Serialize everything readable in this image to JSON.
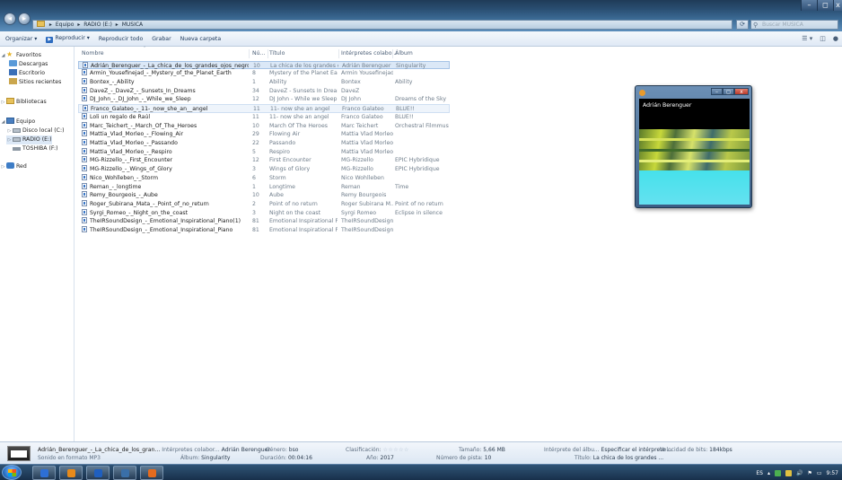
{
  "window": {
    "breadcrumb": [
      "Equipo",
      "RADIO (E:)",
      "MUSICA"
    ],
    "search_placeholder": "Buscar MUSICA",
    "controls": {
      "minimize": "–",
      "maximize": "◻",
      "close": "x"
    }
  },
  "toolbar": {
    "organize": "Organizar ▾",
    "play": "Reproducir ▾",
    "play_all": "Reproducir todo",
    "burn": "Grabar",
    "new_folder": "Nueva carpeta"
  },
  "nav": {
    "favorites": "Favoritos",
    "downloads": "Descargas",
    "desktop": "Escritorio",
    "recent": "Sitios recientes",
    "libraries": "Bibliotecas",
    "computer": "Equipo",
    "local_disk": "Disco local (C:)",
    "radio": "RADIO (E:)",
    "toshiba": "TOSHIBA (F:)",
    "network": "Red"
  },
  "columns": {
    "name": "Nombre",
    "num": "Nú...",
    "title": "Título",
    "artists": "Intérpretes colabo...",
    "album": "Álbum"
  },
  "files": [
    {
      "name": "Adrián_Berenguer_-_La_chica_de_los_grandes_ojos_negros",
      "num": "10",
      "title": "La chica de los grandes oj...",
      "artist": "Adrián Berenguer",
      "album": "Singularity"
    },
    {
      "name": "Armin_Yousefinejad_-_Mystery_of_the_Planet_Earth",
      "num": "8",
      "title": "Mystery of the Planet Earth",
      "artist": "Armin Yousefinejad",
      "album": ""
    },
    {
      "name": "Bontex_-_Ability",
      "num": "1",
      "title": "Ability",
      "artist": "Bontex",
      "album": "Ability"
    },
    {
      "name": "DaveZ_-_DaveZ_-_Sunsets_In_Dreams",
      "num": "34",
      "title": "DaveZ - Sunsets In Dreams",
      "artist": "DaveZ",
      "album": ""
    },
    {
      "name": "DJ_John_-_DJ_John_-_While_we_Sleep",
      "num": "12",
      "title": "DJ John - While we Sleep",
      "artist": "DJ John",
      "album": "Dreams of the Sky"
    },
    {
      "name": "Franco_Galateo_-_11-_now_she_an__angel",
      "num": "11",
      "title": "11- now she an angel",
      "artist": "Franco Galateo",
      "album": "BLUE!!"
    },
    {
      "name": "Loli un regalo de Raúl",
      "num": "11",
      "title": "11- now she an angel",
      "artist": "Franco Galateo",
      "album": "BLUE!!"
    },
    {
      "name": "Marc_Teichert_-_March_Of_The_Heroes",
      "num": "10",
      "title": "March Of The Heroes",
      "artist": "Marc Teichert",
      "album": "Orchestral Filmmusic..."
    },
    {
      "name": "Mattia_Vlad_Morleo_-_Flowing_Air",
      "num": "29",
      "title": "Flowing Air",
      "artist": "Mattia Vlad Morleo",
      "album": ""
    },
    {
      "name": "Mattia_Vlad_Morleo_-_Passando",
      "num": "22",
      "title": "Passando",
      "artist": "Mattia Vlad Morleo",
      "album": ""
    },
    {
      "name": "Mattia_Vlad_Morleo_-_Respiro",
      "num": "5",
      "title": "Respiro",
      "artist": "Mattia Vlad Morleo",
      "album": ""
    },
    {
      "name": "MG-Rizzello_-_First_Encounter",
      "num": "12",
      "title": "First Encounter",
      "artist": "MG-Rizzello",
      "album": "EPIC Hybridique"
    },
    {
      "name": "MG-Rizzello_-_Wings_of_Glory",
      "num": "3",
      "title": "Wings of Glory",
      "artist": "MG-Rizzello",
      "album": "EPIC Hybridique"
    },
    {
      "name": "Nico_Wohlleben_-_Storm",
      "num": "6",
      "title": "Storm",
      "artist": "Nico Wohlleben",
      "album": ""
    },
    {
      "name": "Reman_-_longtime",
      "num": "1",
      "title": "Longtime",
      "artist": "Reman",
      "album": "Time"
    },
    {
      "name": "Remy_Bourgeois_-_Aube",
      "num": "10",
      "title": "Aube",
      "artist": "Remy Bourgeois",
      "album": ""
    },
    {
      "name": "Roger_Subirana_Mata_-_Point_of_no_return",
      "num": "2",
      "title": "Point of no return",
      "artist": "Roger Subirana M...",
      "album": "Point of no return"
    },
    {
      "name": "Syrgi_Romeo_-_Night_on_the_coast",
      "num": "3",
      "title": "Night on the coast",
      "artist": "Syrgi Romeo",
      "album": "Eclipse in silence"
    },
    {
      "name": "TheIRSoundDesign_-_Emotional_Inspirational_Piano(1)",
      "num": "81",
      "title": "Emotional Inspirational Pi...",
      "artist": "TheIRSoundDesign",
      "album": ""
    },
    {
      "name": "TheIRSoundDesign_-_Emotional_Inspirational_Piano",
      "num": "81",
      "title": "Emotional Inspirational Pi...",
      "artist": "TheIRSoundDesign",
      "album": ""
    }
  ],
  "preview": {
    "artist": "Adrián Berenguer",
    "controls": {
      "minimize": "–",
      "maximize": "◻",
      "close": "x"
    }
  },
  "details": {
    "file_name": "Adrián_Berenguer_-_La_chica_de_los_gran...",
    "file_type": "Sonido en formato MP3",
    "artists_label": "Intérpretes colabor...",
    "artists_value": "Adrián Berenguer",
    "album_label": "Álbum:",
    "album_value": "Singularity",
    "genre_label": "Género:",
    "genre_value": "bso",
    "duration_label": "Duración:",
    "duration_value": "00:04:16",
    "rating_label": "Clasificación:",
    "rating_stars": "☆☆☆☆☆",
    "year_label": "Año:",
    "year_value": "2017",
    "size_label": "Tamaño:",
    "size_value": "5,66 MB",
    "track_label": "Número de pista:",
    "track_value": "10",
    "album_artist_label": "Intérprete del álbu...",
    "album_artist_value": "Especificar el intérprete ...",
    "title_label": "Título:",
    "title_value": "La chica de los grandes ...",
    "bitrate_label": "Velocidad de bits:",
    "bitrate_value": "184kbps"
  },
  "taskbar": {
    "lang": "ES",
    "time": "9:57",
    "date": "",
    "colors": [
      "#2d6fd6",
      "#e88a1a",
      "#1f5fbf",
      "#3a6fa8",
      "#e46b1f"
    ]
  }
}
